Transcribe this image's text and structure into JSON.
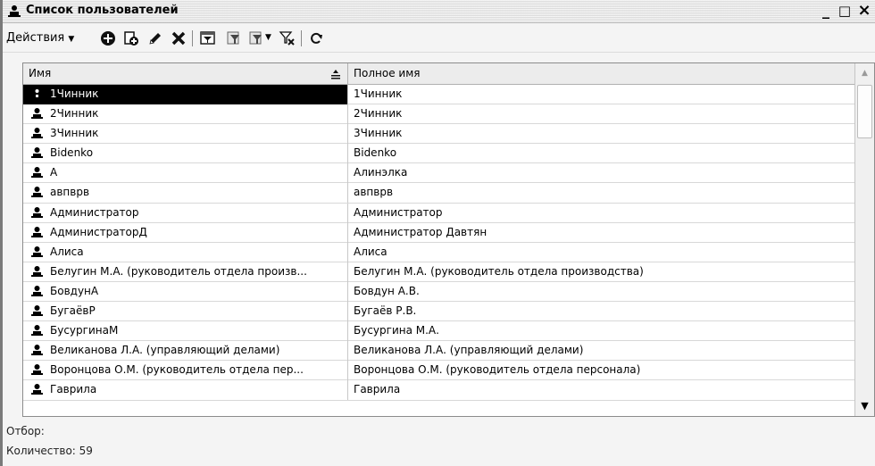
{
  "window": {
    "title": "Список пользователей",
    "minimize_label": "_",
    "maximize_label": "□",
    "close_label": "×"
  },
  "toolbar": {
    "actions_label": "Действия",
    "buttons": [
      "add-icon",
      "copy-icon",
      "edit-icon",
      "delete-icon",
      "filter-set-icon",
      "filter-by-value-icon",
      "filter-history-icon",
      "filter-clear-icon",
      "refresh-icon"
    ]
  },
  "table": {
    "columns": [
      "Имя",
      "Полное имя"
    ],
    "rows": [
      {
        "name": "1Чинник",
        "full": "1Чинник",
        "selected": true
      },
      {
        "name": "2Чинник",
        "full": "2Чинник"
      },
      {
        "name": "3Чинник",
        "full": "3Чинник"
      },
      {
        "name": "Bidenko",
        "full": "Bidenko"
      },
      {
        "name": "А",
        "full": " Алинэлка"
      },
      {
        "name": "авпврв",
        "full": "авпврв"
      },
      {
        "name": "Администратор",
        "full": "Администратор"
      },
      {
        "name": "АдминистраторД",
        "full": "Администратор Давтян"
      },
      {
        "name": "Алиса",
        "full": "Алиса"
      },
      {
        "name": "Белугин М.А. (руководитель отдела произв...",
        "full": "Белугин М.А. (руководитель отдела производства)"
      },
      {
        "name": "БовдунА",
        "full": "Бовдун А.В."
      },
      {
        "name": "БугаёвР",
        "full": "Бугаёв Р.В."
      },
      {
        "name": "БусургинаМ",
        "full": "Бусургина М.А."
      },
      {
        "name": "Великанова Л.А. (управляющий делами)",
        "full": "Великанова Л.А. (управляющий делами)"
      },
      {
        "name": "Воронцова О.М. (руководитель отдела пер...",
        "full": "Воронцова О.М. (руководитель отдела персонала)"
      },
      {
        "name": "Гаврила",
        "full": "Гаврила"
      }
    ]
  },
  "footer": {
    "filter_label": "Отбор:",
    "count_label": "Количество: 59"
  }
}
